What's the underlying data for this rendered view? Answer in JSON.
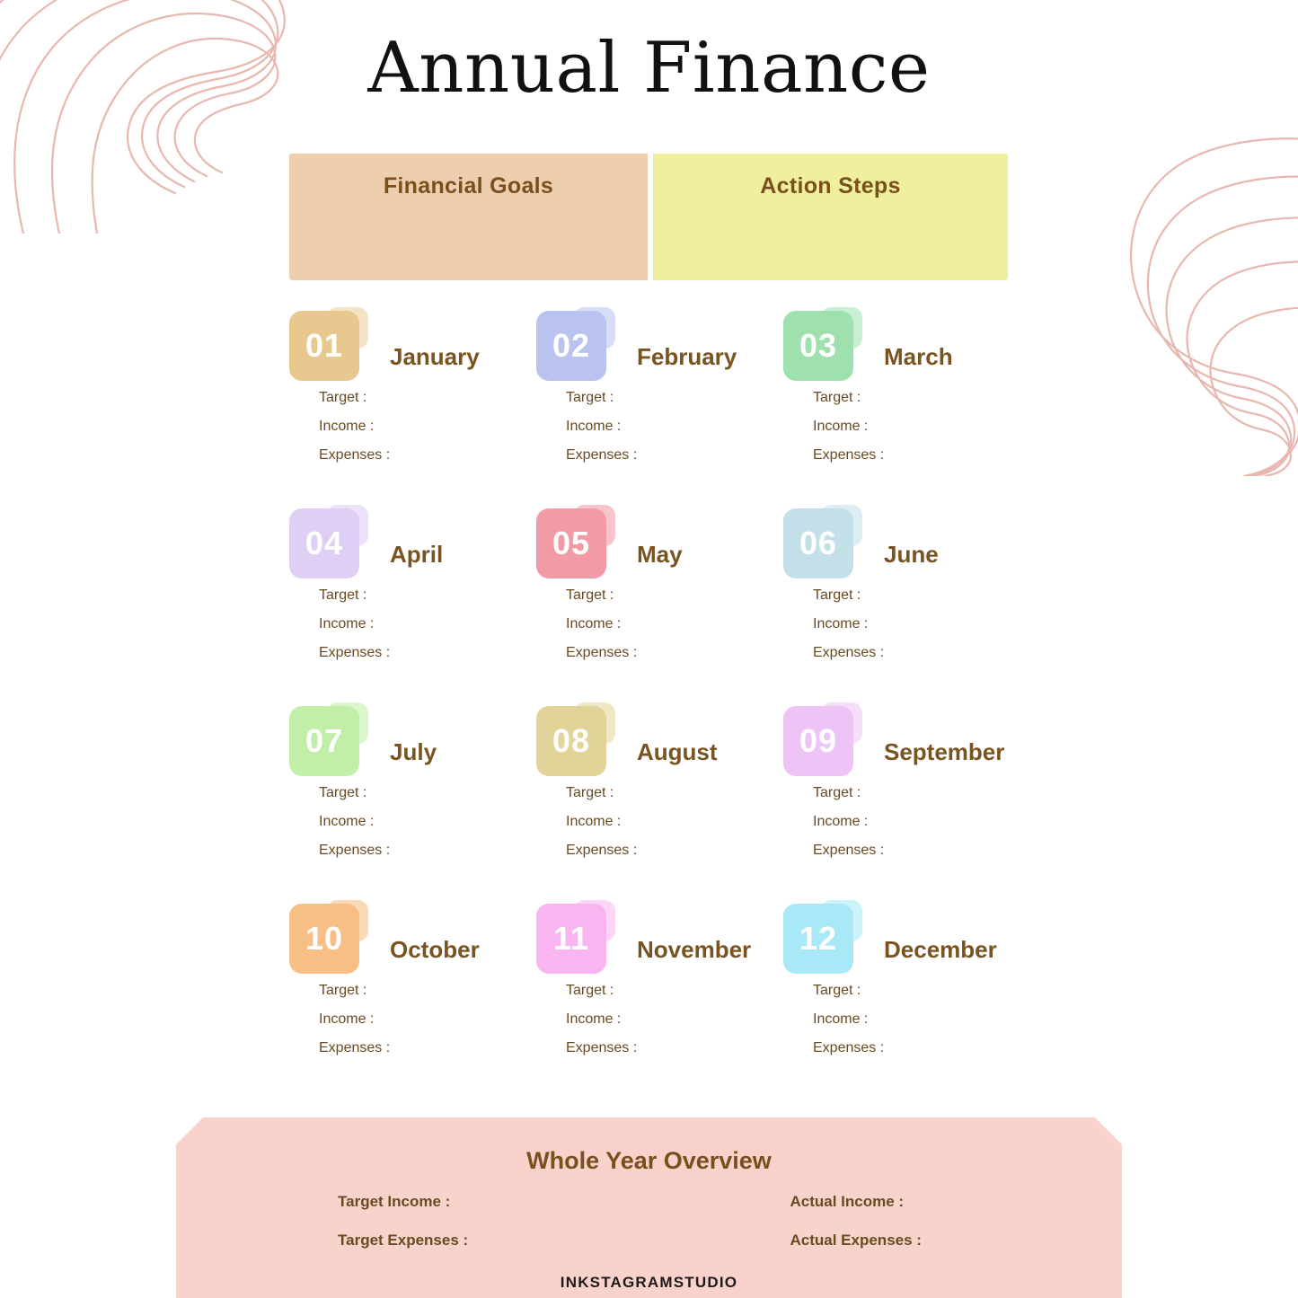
{
  "page": {
    "title": "Annual Finance",
    "background_color": "#FFFFFF",
    "decor_line_color": "#E8B8B0"
  },
  "header": {
    "panels": [
      {
        "label": "Financial Goals",
        "color": "#EDCFAF"
      },
      {
        "label": "Action Steps",
        "color": "#EFEF9E"
      }
    ]
  },
  "field_labels": {
    "target": "Target  :",
    "income": "Income :",
    "expenses": "Expenses :"
  },
  "months": [
    {
      "number": "01",
      "name": "January",
      "badge_color": "#E8C88E",
      "tab_color": "#F3E4C8"
    },
    {
      "number": "02",
      "name": "February",
      "badge_color": "#BAC2F0",
      "tab_color": "#D7DCF7"
    },
    {
      "number": "03",
      "name": "March",
      "badge_color": "#9EE0AE",
      "tab_color": "#C8EFD2"
    },
    {
      "number": "04",
      "name": "April",
      "badge_color": "#E0CFF5",
      "tab_color": "#EDE1FA"
    },
    {
      "number": "05",
      "name": "May",
      "badge_color": "#F29AA5",
      "tab_color": "#F8C4CB"
    },
    {
      "number": "06",
      "name": "June",
      "badge_color": "#C3DFE8",
      "tab_color": "#DCEDF3"
    },
    {
      "number": "07",
      "name": "July",
      "badge_color": "#C2EFA8",
      "tab_color": "#DBF6CA"
    },
    {
      "number": "08",
      "name": "August",
      "badge_color": "#E2D398",
      "tab_color": "#F0E8C4"
    },
    {
      "number": "09",
      "name": "September",
      "badge_color": "#EDC4F5",
      "tab_color": "#F5DEF9"
    },
    {
      "number": "10",
      "name": "October",
      "badge_color": "#F7BE85",
      "tab_color": "#FBD9B6"
    },
    {
      "number": "11",
      "name": "November",
      "badge_color": "#F9B5F0",
      "tab_color": "#FCD5F7"
    },
    {
      "number": "12",
      "name": "December",
      "badge_color": "#A8E8F7",
      "tab_color": "#CCF2FA"
    }
  ],
  "overview": {
    "title": "Whole Year Overview",
    "background_color": "#F9D2CB",
    "rows": [
      {
        "left": "Target Income :",
        "right": "Actual Income :"
      },
      {
        "left": "Target  Expenses :",
        "right": "Actual  Expenses :"
      }
    ]
  },
  "footer": {
    "brand": "INKSTAGRAMSTUDIO"
  }
}
